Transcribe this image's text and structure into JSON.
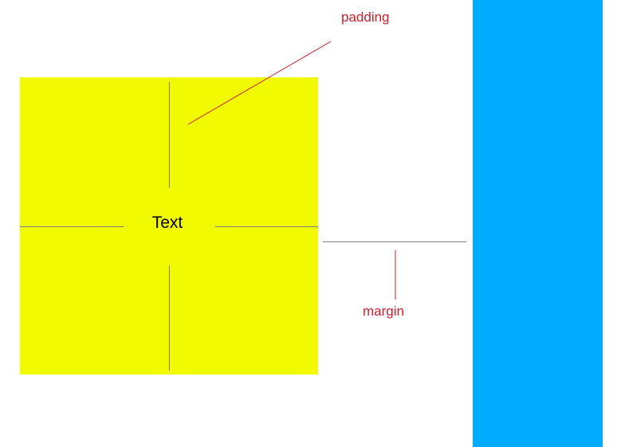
{
  "diagram": {
    "content_text": "Text",
    "padding_label": "padding",
    "margin_label": "margin"
  },
  "colors": {
    "content_box": "#f2fa00",
    "neighbor_box": "#00aaff",
    "measure_line": "#808080",
    "annotation": "#d0202a"
  }
}
